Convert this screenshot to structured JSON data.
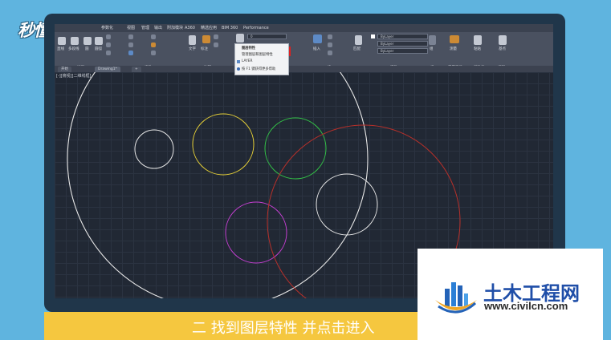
{
  "watermark": {
    "text": "秒懂视频"
  },
  "menubar": {
    "items": [
      "参数化",
      "视图",
      "管理",
      "输出",
      "附加模块",
      "A360",
      "精选应用",
      "BIM 360",
      "Performance"
    ]
  },
  "ribbon": {
    "panels": [
      {
        "label": "绘图"
      },
      {
        "label": "修改"
      },
      {
        "label": "注释"
      },
      {
        "label": "图层"
      },
      {
        "label": "块"
      },
      {
        "label": "特性"
      },
      {
        "label": "组"
      },
      {
        "label": "实用工具"
      },
      {
        "label": "剪贴板"
      },
      {
        "label": "视图"
      }
    ],
    "buttons": {
      "line": "直线",
      "polyline": "多段线",
      "circle": "圆",
      "arc": "圆弧",
      "text": "文字",
      "dimension": "标注",
      "insert": "插入",
      "layer_properties": "图层特性",
      "match": "匹配",
      "group": "组",
      "measure": "测量",
      "paste": "粘贴",
      "base": "基点"
    },
    "combos": {
      "color": "ByLayer",
      "linetype": "ByLayer",
      "lineweight": "ByLayer",
      "layer": "0"
    }
  },
  "dropdown": {
    "items": [
      "图层特性",
      "管理图层和图层特性",
      "LAYER",
      "按 F1 键获得更多帮助"
    ]
  },
  "tabs": [
    "开始",
    "Drawing1*"
  ],
  "viewport_label": "[-][俯视][二维线框]",
  "drawing": {
    "colors": {
      "white": "#e8e8e8",
      "yellow": "#e8d237",
      "green": "#33c447",
      "red": "#b8302a",
      "magenta": "#c63fd3"
    }
  },
  "caption": {
    "text": "二 找到图层特性 并点击进入"
  },
  "badge": {
    "name": "土木工程网",
    "url": "www.civilcn.com"
  }
}
